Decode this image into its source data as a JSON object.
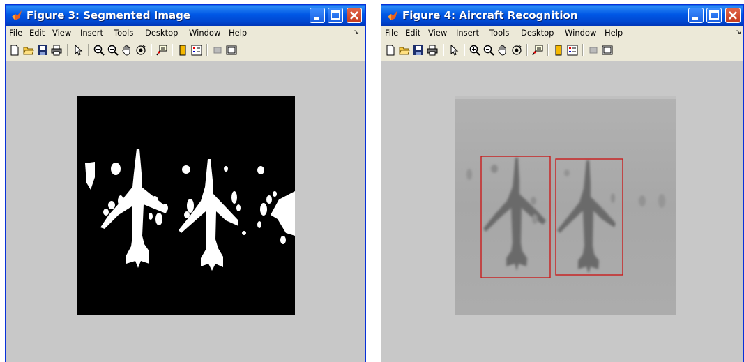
{
  "windows": [
    {
      "title": "Figure 3: Segmented Image",
      "menu": [
        "File",
        "Edit",
        "View",
        "Insert",
        "Tools",
        "Desktop",
        "Window",
        "Help"
      ]
    },
    {
      "title": "Figure 4: Aircraft Recognition",
      "menu": [
        "File",
        "Edit",
        "View",
        "Insert",
        "Tools",
        "Desktop",
        "Window",
        "Help"
      ]
    }
  ],
  "toolbar_icons": [
    "new-file-icon",
    "open-folder-icon",
    "save-icon",
    "print-icon",
    "pointer-icon",
    "zoom-in-icon",
    "zoom-out-icon",
    "pan-hand-icon",
    "rotate-3d-icon",
    "data-cursor-icon",
    "colorbar-icon",
    "legend-icon",
    "hide-plot-tools-icon",
    "show-plot-tools-icon"
  ],
  "colors": {
    "title_bar": "#0058e6",
    "menu_bg": "#ece9d8",
    "figure_bg": "#c8c8c8",
    "segmented_bg": "#000000",
    "segmented_fg": "#ffffff",
    "recognition_box": "#cc1111"
  },
  "recognition": {
    "detected_count": 2
  }
}
